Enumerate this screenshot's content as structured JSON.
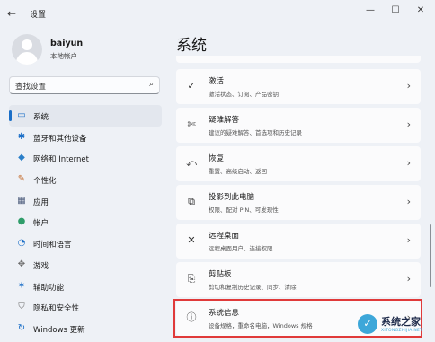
{
  "window": {
    "back_glyph": "←",
    "title": "设置",
    "minimize_glyph": "—",
    "maximize_glyph": "☐",
    "close_glyph": "✕"
  },
  "profile": {
    "name": "baiyun",
    "subtitle": "本地帐户"
  },
  "search": {
    "placeholder": "查找设置"
  },
  "sidebar": {
    "items": [
      {
        "label": "系统",
        "icon": "monitor-icon",
        "glyph": "▭",
        "color": "#1a6ec7",
        "active": true
      },
      {
        "label": "蓝牙和其他设备",
        "icon": "bluetooth-icon",
        "glyph": "✱",
        "color": "#1a6ec7"
      },
      {
        "label": "网络和 Internet",
        "icon": "wifi-icon",
        "glyph": "◆",
        "color": "#2a7fc9"
      },
      {
        "label": "个性化",
        "icon": "brush-icon",
        "glyph": "✎",
        "color": "#c46a2a"
      },
      {
        "label": "应用",
        "icon": "apps-icon",
        "glyph": "▦",
        "color": "#4a5a7a"
      },
      {
        "label": "帐户",
        "icon": "account-icon",
        "glyph": "●",
        "color": "#2f9d6a"
      },
      {
        "label": "时间和语言",
        "icon": "globe-clock-icon",
        "glyph": "◔",
        "color": "#1a6ec7"
      },
      {
        "label": "游戏",
        "icon": "gamepad-icon",
        "glyph": "✥",
        "color": "#6b6b6b"
      },
      {
        "label": "辅助功能",
        "icon": "accessibility-icon",
        "glyph": "✶",
        "color": "#1a6ec7"
      },
      {
        "label": "隐私和安全性",
        "icon": "shield-icon",
        "glyph": "⛉",
        "color": "#6b6b6b"
      },
      {
        "label": "Windows 更新",
        "icon": "update-icon",
        "glyph": "↻",
        "color": "#1a6ec7"
      }
    ]
  },
  "main": {
    "title": "系统",
    "cards": [
      {
        "title": "激活",
        "desc": "激活状态、订阅、产品密钥",
        "icon": "activation-check-icon",
        "glyph": "✓"
      },
      {
        "title": "疑难解答",
        "desc": "建议的疑难解答、首选项和历史记录",
        "icon": "wrench-icon",
        "glyph": "✄"
      },
      {
        "title": "恢复",
        "desc": "重置、高级启动、返回",
        "icon": "recovery-icon",
        "glyph": "⤺"
      },
      {
        "title": "投影到此电脑",
        "desc": "权限、配对 PIN、可发现性",
        "icon": "project-screen-icon",
        "glyph": "⧉"
      },
      {
        "title": "远程桌面",
        "desc": "远程桌面用户、连接权限",
        "icon": "remote-desktop-icon",
        "glyph": "✕"
      },
      {
        "title": "剪贴板",
        "desc": "剪切和复制历史记录、同步、清除",
        "icon": "clipboard-icon",
        "glyph": "⎘"
      },
      {
        "title": "系统信息",
        "desc": "设备规格，重命名电脑，Windows 规格",
        "icon": "info-icon",
        "glyph": "ⓘ"
      }
    ],
    "chevron_glyph": "›",
    "highlight_color": "#e03a3a"
  },
  "watermark": {
    "badge": "✓",
    "text": "系统之家",
    "sub": "XITONGZHIJIA.NET"
  }
}
